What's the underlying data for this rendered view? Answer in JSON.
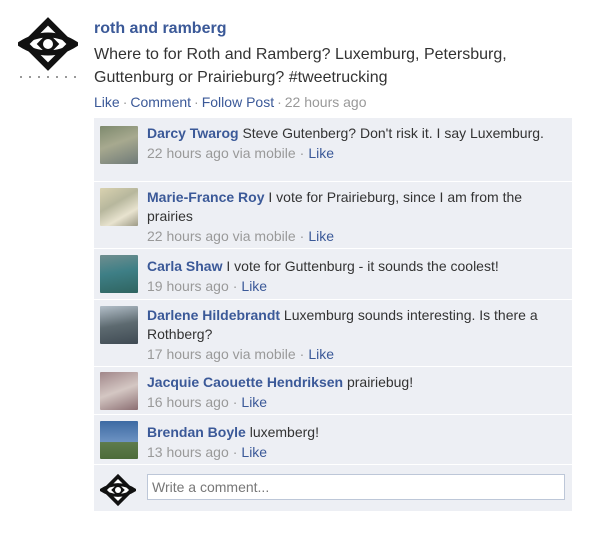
{
  "post": {
    "author": "roth and ramberg",
    "text": "Where to for Roth and Ramberg? Luxemburg, Petersburg, Guttenburg or Prairieburg? #tweetrucking",
    "actions": {
      "like": "Like",
      "comment": "Comment",
      "follow": "Follow Post",
      "timestamp": "22 hours ago",
      "separator": "·"
    }
  },
  "comments": [
    {
      "name": "Darcy Twarog",
      "text": "Steve Gutenberg? Don't risk it. I say Luxemburg.",
      "time": "22 hours ago via mobile",
      "like": "Like"
    },
    {
      "name": "Marie-France Roy",
      "text": "I vote for Prairieburg, since I am from the prairies",
      "time": "22 hours ago via mobile",
      "like": "Like"
    },
    {
      "name": "Carla Shaw",
      "text": "I vote for Guttenburg - it sounds the coolest!",
      "time": "19 hours ago",
      "like": "Like"
    },
    {
      "name": "Darlene Hildebrandt",
      "text": "Luxemburg sounds interesting. Is there a Rothberg?",
      "time": "17 hours ago via mobile",
      "like": "Like"
    },
    {
      "name": "Jacquie Caouette Hendriksen",
      "text": "prairiebug!",
      "time": "16 hours ago",
      "like": "Like"
    },
    {
      "name": "Brendan Boyle",
      "text": "luxemberg!",
      "time": "13 hours ago",
      "like": "Like"
    }
  ],
  "composer": {
    "placeholder": "Write a comment..."
  },
  "colors": {
    "link": "#3b5998",
    "comment_bg": "#edeff4",
    "meta": "#999999"
  },
  "icons": {
    "page_logo": "roth-ramberg-logo-icon"
  }
}
